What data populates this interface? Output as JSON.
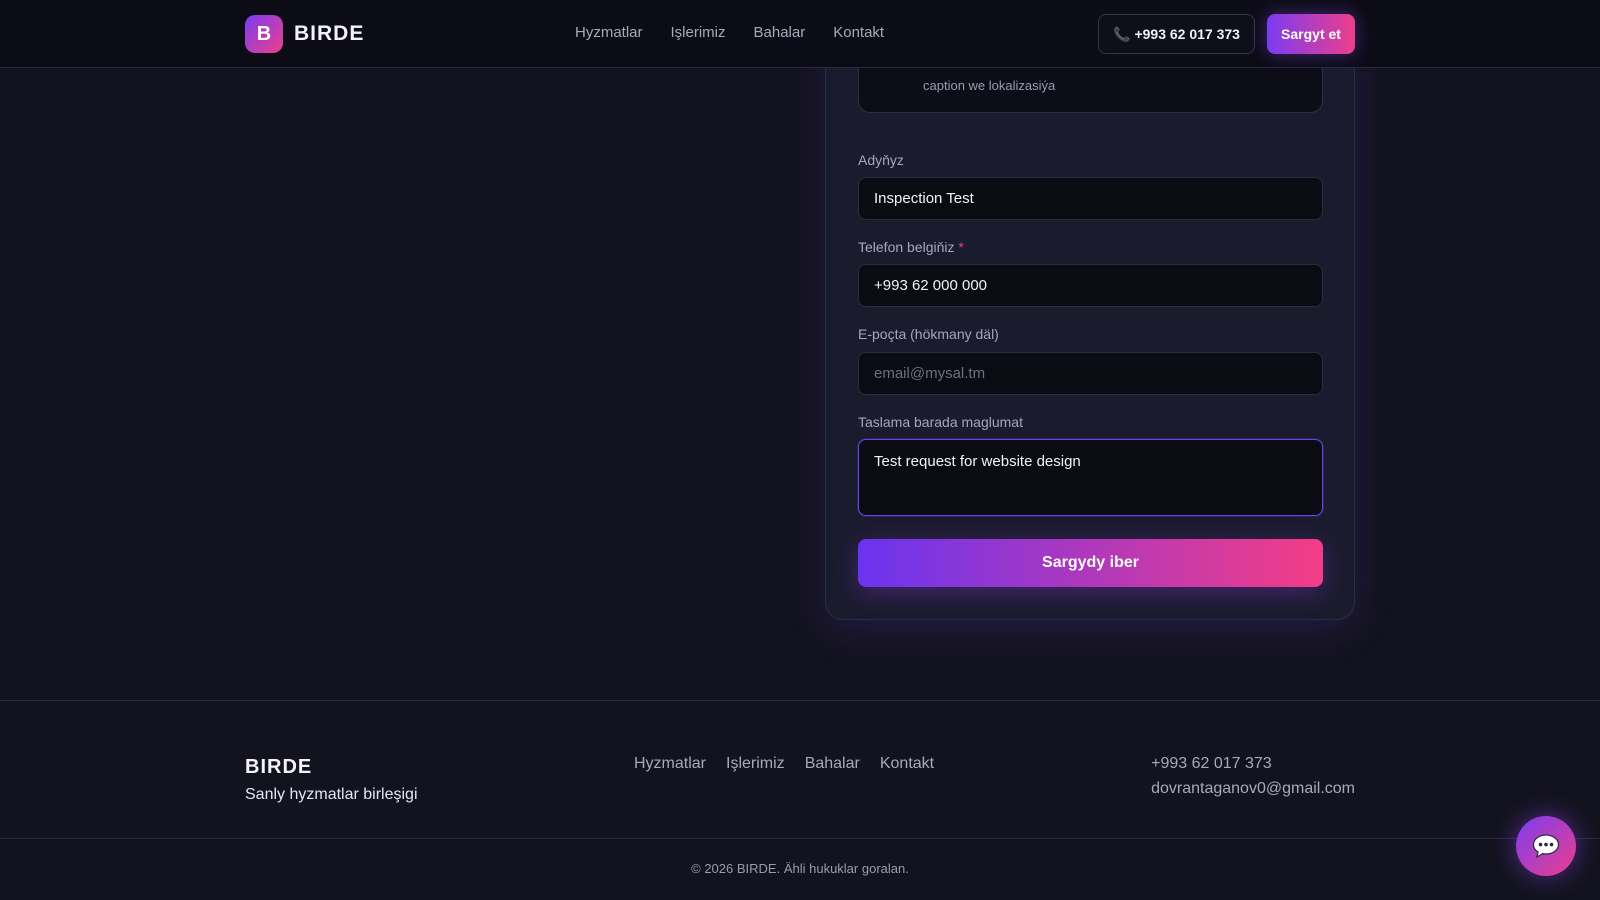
{
  "header": {
    "brand_letter": "B",
    "brand_name": "BIRDE",
    "nav": [
      "Hyzmatlar",
      "Işlerimiz",
      "Bahalar",
      "Kontakt"
    ],
    "phone": "+993 62 017 373",
    "phone_icon": "phone-icon",
    "order_label": "Sargyt et"
  },
  "form": {
    "service_desc": "caption we lokalizasiýa",
    "name_label": "Adyňyz",
    "name_value": "Inspection Test",
    "phone_label": "Telefon belgiňiz",
    "phone_required": "*",
    "phone_value": "+993 62 000 000",
    "email_label": "E-poçta (hökmany däl)",
    "email_placeholder": "email@mysal.tm",
    "details_label": "Taslama barada maglumat",
    "details_value": "Test request for website design",
    "submit_label": "Sargydy iber"
  },
  "footer": {
    "brand": "BIRDE",
    "tagline": "Sanly hyzmatlar birleşigi",
    "links": [
      "Hyzmatlar",
      "Işlerimiz",
      "Bahalar",
      "Kontakt"
    ],
    "phone": "+993 62 017 373",
    "email": "dovrantaganov0@gmail.com",
    "copyright": "© 2026 BIRDE. Ähli hukuklar goralan."
  },
  "chat": {
    "icon": "chat-bubble-icon"
  },
  "colors": {
    "accent_purple": "#7b3cf2",
    "accent_pink": "#ec3f8a",
    "background": "#13131f"
  }
}
